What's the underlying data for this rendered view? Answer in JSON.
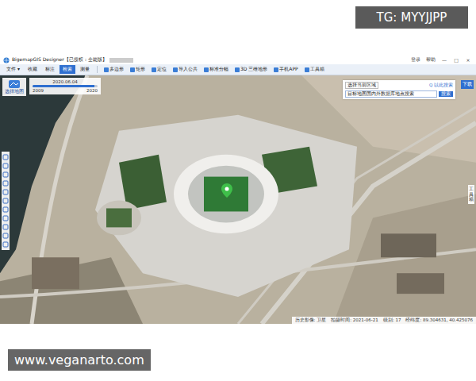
{
  "watermarks": {
    "top": "TG: MYYJJPP",
    "bottom": "www.veganarto.com"
  },
  "window": {
    "title": "BigemapGIS Designer【已授权：全能版】",
    "account": [
      "登录",
      "帮助"
    ],
    "controls": [
      "—",
      "□",
      "×"
    ]
  },
  "menu_tabs": [
    {
      "label": "文件 ▾",
      "selected": false
    },
    {
      "label": "收藏",
      "selected": false
    },
    {
      "label": "标注",
      "selected": false
    },
    {
      "label": "检索",
      "selected": true
    },
    {
      "label": "测量",
      "selected": false
    }
  ],
  "toolbar": [
    "多边形",
    "矩形",
    "定位",
    "导入公共",
    "标准分幅",
    "3D 三维地形",
    "手机APP",
    "工具箱"
  ],
  "map_selector": {
    "label": "选择地图"
  },
  "timeline": {
    "date": "2020.06.04",
    "start": "2009",
    "end": "2020",
    "level": 0.95
  },
  "search": {
    "scope": "选择当前区域",
    "button": "Q 以此搜索",
    "value": "目标地图国内外数据库地点搜索",
    "go": "搜索",
    "side_button": "下载"
  },
  "side_panel": {
    "label": "工具箱"
  },
  "status_bar": [
    "历史影像: 卫星",
    "拍摄时间: 2021-06-21",
    "级别: 17",
    "经纬度: 89.304631, 40.425076"
  ]
}
